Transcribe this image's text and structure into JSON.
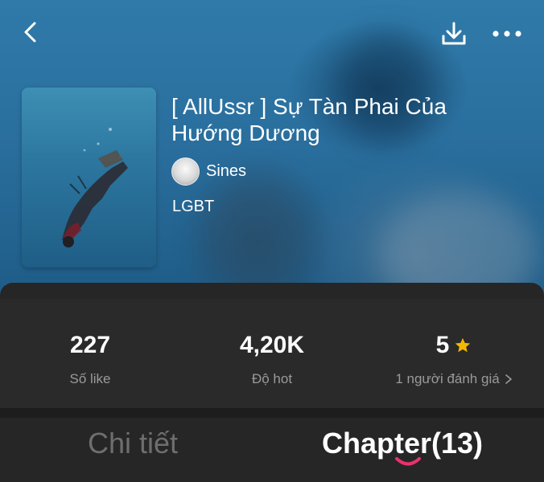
{
  "book": {
    "title": "[ AllUssr ] Sự Tàn Phai Của Hướng Dương",
    "author": "Sines",
    "genre": "LGBT"
  },
  "stats": {
    "likes_value": "227",
    "likes_label": "Số like",
    "hot_value": "4,20K",
    "hot_label": "Độ hot",
    "rating_value": "5",
    "rating_label": "1 người đánh giá"
  },
  "tabs": {
    "details_label": "Chi tiết",
    "chapter_label": "Chapter(13)"
  },
  "colors": {
    "accent_star": "#f5b800",
    "accent_indicator": "#e8336d"
  },
  "icons": {
    "back": "chevron-left-icon",
    "download": "download-icon",
    "more": "more-horizontal-icon",
    "star": "star-icon",
    "chevron": "chevron-right-icon"
  }
}
